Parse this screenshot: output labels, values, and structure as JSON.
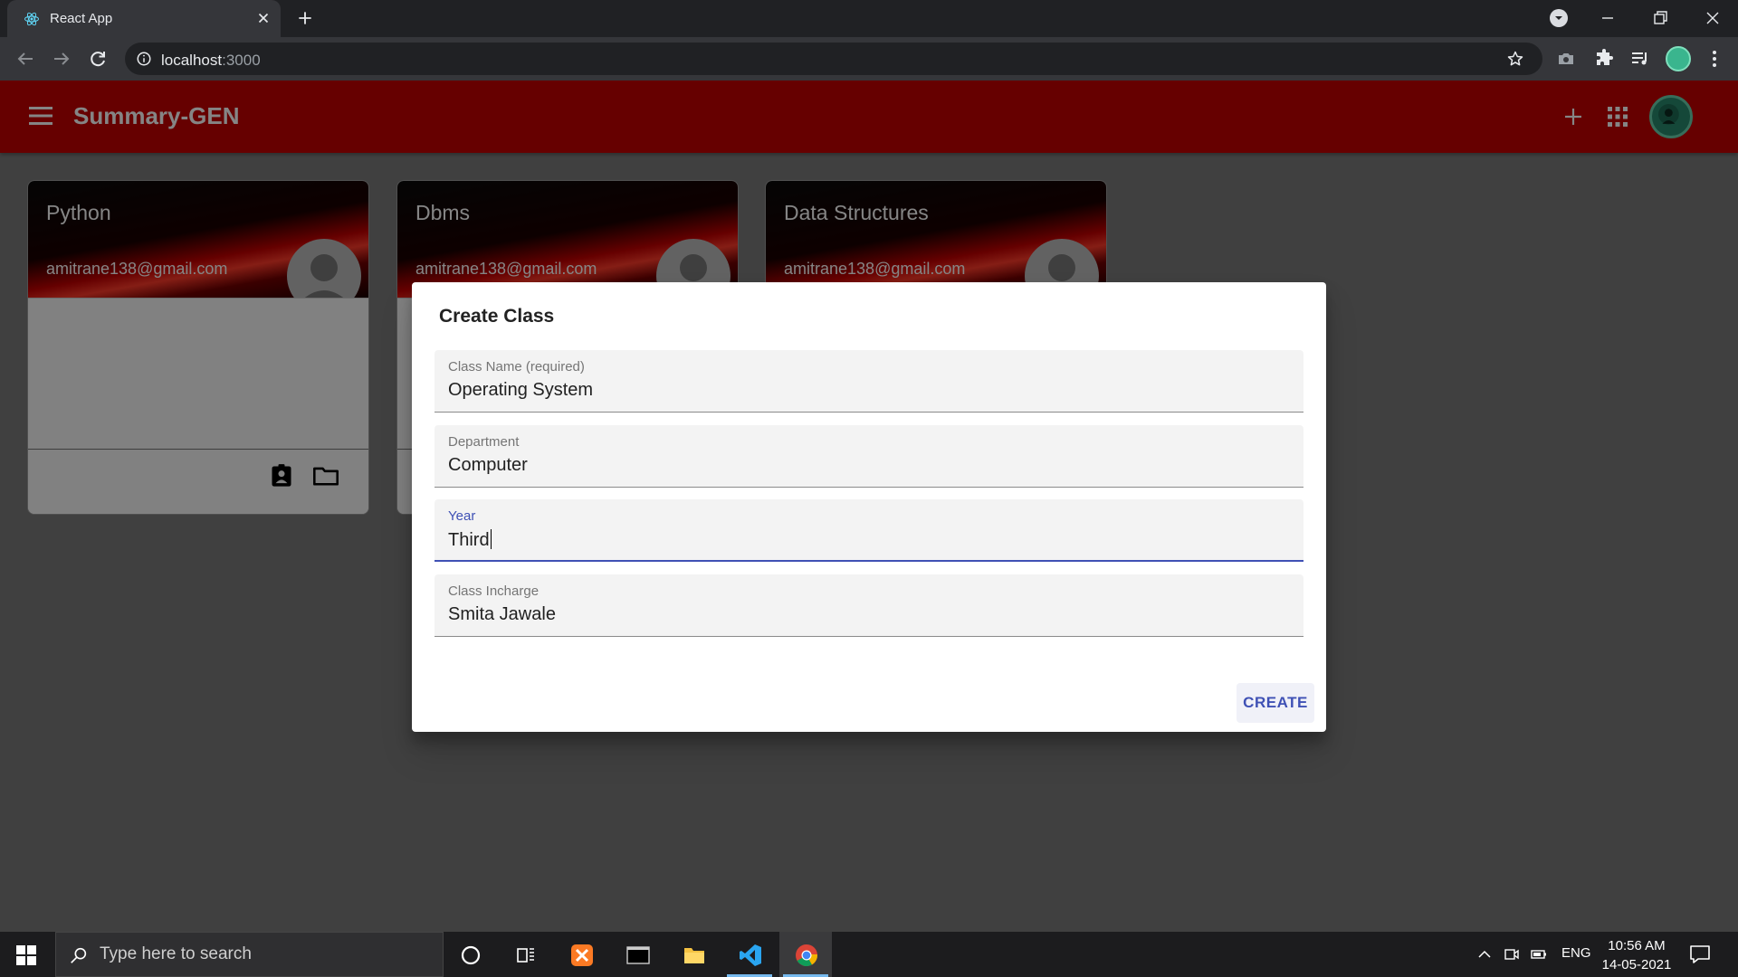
{
  "browser": {
    "tab_title": "React App",
    "url_host": "localhost",
    "url_port": ":3000"
  },
  "app": {
    "title": "Summary-GEN"
  },
  "classes": [
    {
      "name": "Python",
      "email": "amitrane138@gmail.com"
    },
    {
      "name": "Dbms",
      "email": "amitrane138@gmail.com"
    },
    {
      "name": "Data Structures",
      "email": "amitrane138@gmail.com"
    }
  ],
  "dialog": {
    "title": "Create Class",
    "fields": [
      {
        "label": "Class Name (required)",
        "value": "Operating System"
      },
      {
        "label": "Department",
        "value": "Computer"
      },
      {
        "label": "Year",
        "value": "Third"
      },
      {
        "label": "Class Incharge",
        "value": "Smita Jawale"
      }
    ],
    "create_label": "CREATE"
  },
  "taskbar": {
    "search_placeholder": "Type here to search",
    "language": "ENG",
    "time": "10:56 AM",
    "date": "14-05-2021"
  },
  "colors": {
    "appbar": "#c40000",
    "accent": "#3f51b5"
  }
}
